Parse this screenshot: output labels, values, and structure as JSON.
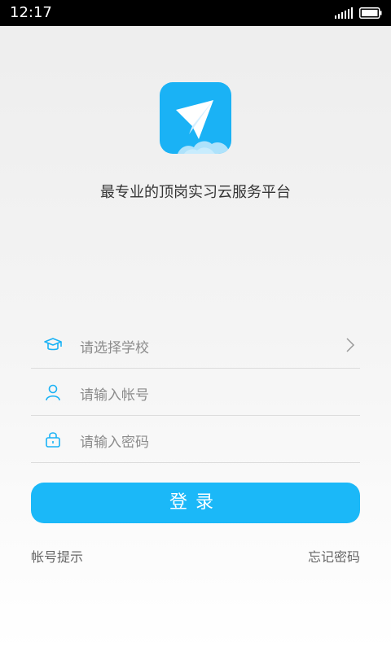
{
  "status_bar": {
    "time": "12:17",
    "icons": [
      "signal-icon",
      "battery-icon"
    ]
  },
  "app": {
    "logo_icon": "paper-plane-icon",
    "slogan": "最专业的顶岗实习云服务平台",
    "brand_color": "#1ab2f5"
  },
  "form": {
    "school": {
      "icon": "graduation-cap-icon",
      "placeholder": "请选择学校",
      "trailing_icon": "chevron-right-icon"
    },
    "account": {
      "icon": "user-icon",
      "placeholder": "请输入帐号"
    },
    "password": {
      "icon": "lock-icon",
      "placeholder": "请输入密码"
    }
  },
  "actions": {
    "login_label": "登录",
    "account_hint": "帐号提示",
    "forgot_password": "忘记密码"
  }
}
